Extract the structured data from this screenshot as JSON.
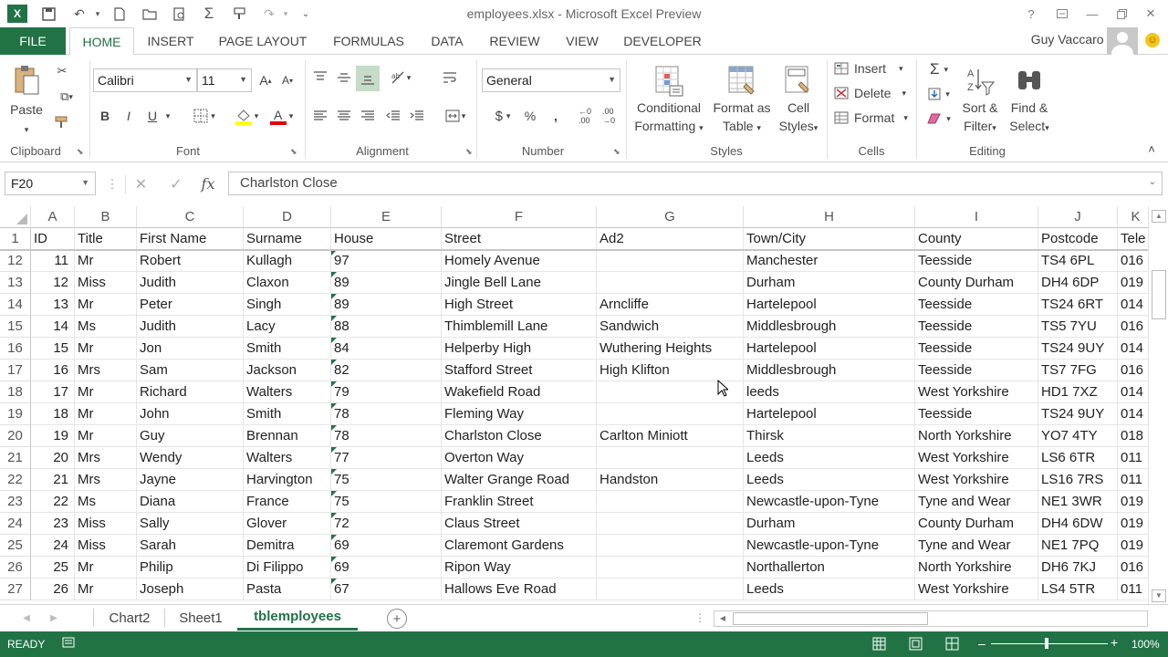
{
  "window": {
    "title": "employees.xlsx - Microsoft Excel Preview"
  },
  "ribbon_tabs": [
    "FILE",
    "HOME",
    "INSERT",
    "PAGE LAYOUT",
    "FORMULAS",
    "DATA",
    "REVIEW",
    "VIEW",
    "DEVELOPER"
  ],
  "active_tab": "HOME",
  "user": "Guy Vaccaro",
  "ribbon": {
    "clipboard": {
      "paste": "Paste",
      "label": "Clipboard"
    },
    "font": {
      "name": "Calibri",
      "size": "11",
      "label": "Font",
      "bold": "B",
      "italic": "I",
      "underline": "U"
    },
    "alignment": {
      "label": "Alignment"
    },
    "number": {
      "format": "General",
      "label": "Number",
      "currency": "$",
      "percent": "%"
    },
    "styles": {
      "conditional": [
        "Conditional",
        "Formatting"
      ],
      "format_table": [
        "Format as",
        "Table"
      ],
      "cell_styles": [
        "Cell",
        "Styles"
      ],
      "label": "Styles"
    },
    "cells": {
      "insert": "Insert",
      "delete": "Delete",
      "format": "Format",
      "label": "Cells"
    },
    "editing": {
      "sort": [
        "Sort &",
        "Filter"
      ],
      "find": [
        "Find &",
        "Select"
      ],
      "label": "Editing"
    }
  },
  "formula_bar": {
    "name_box": "F20",
    "fx": "fx",
    "content": "Charlston Close"
  },
  "columns": [
    "A",
    "B",
    "C",
    "D",
    "E",
    "F",
    "G",
    "H",
    "I",
    "J",
    "K"
  ],
  "header_row": {
    "row": "1",
    "cells": [
      "ID",
      "Title",
      "First Name",
      "Surname",
      "House",
      "Street",
      "Ad2",
      "Town/City",
      "County",
      "Postcode",
      "Tele"
    ]
  },
  "rows": [
    {
      "row": "12",
      "cells": [
        "11",
        "Mr",
        "Robert",
        "Kullagh",
        "97",
        "Homely Avenue",
        "",
        "Manchester",
        "Teesside",
        "TS4 6PL",
        "016"
      ]
    },
    {
      "row": "13",
      "cells": [
        "12",
        "Miss",
        "Judith",
        "Claxon",
        "89",
        "Jingle Bell Lane",
        "",
        "Durham",
        "County Durham",
        "DH4 6DP",
        "019"
      ]
    },
    {
      "row": "14",
      "cells": [
        "13",
        "Mr",
        "Peter",
        "Singh",
        "89",
        "High Street",
        "Arncliffe",
        "Hartelepool",
        "Teesside",
        "TS24 6RT",
        "014"
      ]
    },
    {
      "row": "15",
      "cells": [
        "14",
        "Ms",
        "Judith",
        "Lacy",
        "88",
        "Thimblemill Lane",
        "Sandwich",
        "Middlesbrough",
        "Teesside",
        "TS5 7YU",
        "016"
      ]
    },
    {
      "row": "16",
      "cells": [
        "15",
        "Mr",
        "Jon",
        "Smith",
        "84",
        "Helperby High",
        "Wuthering Heights",
        "Hartelepool",
        "Teesside",
        "TS24 9UY",
        "014"
      ]
    },
    {
      "row": "17",
      "cells": [
        "16",
        "Mrs",
        "Sam",
        "Jackson",
        "82",
        "Stafford Street",
        "High Klifton",
        "Middlesbrough",
        "Teesside",
        "TS7 7FG",
        "016"
      ]
    },
    {
      "row": "18",
      "cells": [
        "17",
        "Mr",
        "Richard",
        "Walters",
        "79",
        "Wakefield Road",
        "",
        "leeds",
        "West Yorkshire",
        "HD1 7XZ",
        "014"
      ]
    },
    {
      "row": "19",
      "cells": [
        "18",
        "Mr",
        "John",
        "Smith",
        "78",
        "Fleming Way",
        "",
        "Hartelepool",
        "Teesside",
        "TS24 9UY",
        "014"
      ]
    },
    {
      "row": "20",
      "cells": [
        "19",
        "Mr",
        "Guy",
        "Brennan",
        "78",
        "Charlston Close",
        "Carlton Miniott",
        "Thirsk",
        "North Yorkshire",
        "YO7 4TY",
        "018"
      ]
    },
    {
      "row": "21",
      "cells": [
        "20",
        "Mrs",
        "Wendy",
        "Walters",
        "77",
        "Overton Way",
        "",
        "Leeds",
        "West Yorkshire",
        "LS6 6TR",
        "011"
      ]
    },
    {
      "row": "22",
      "cells": [
        "21",
        "Mrs",
        "Jayne",
        "Harvington",
        "75",
        "Walter Grange Road",
        "Handston",
        "Leeds",
        "West Yorkshire",
        "LS16 7RS",
        "011"
      ]
    },
    {
      "row": "23",
      "cells": [
        "22",
        "Ms",
        "Diana",
        "France",
        "75",
        "Franklin Street",
        "",
        "Newcastle-upon-Tyne",
        "Tyne and Wear",
        "NE1 3WR",
        "019"
      ]
    },
    {
      "row": "24",
      "cells": [
        "23",
        "Miss",
        "Sally",
        "Glover",
        "72",
        "Claus Street",
        "",
        "Durham",
        "County Durham",
        "DH4 6DW",
        "019"
      ]
    },
    {
      "row": "25",
      "cells": [
        "24",
        "Miss",
        "Sarah",
        "Demitra",
        "69",
        "Claremont Gardens",
        "",
        "Newcastle-upon-Tyne",
        "Tyne and Wear",
        "NE1 7PQ",
        "019"
      ]
    },
    {
      "row": "26",
      "cells": [
        "25",
        "Mr",
        "Philip",
        "Di Filippo",
        "69",
        "Ripon Way",
        "",
        "Northallerton",
        "North Yorkshire",
        "DH6 7KJ",
        "016"
      ]
    },
    {
      "row": "27",
      "cells": [
        "26",
        "Mr",
        "Joseph",
        "Pasta",
        "67",
        "Hallows Eve Road",
        "",
        "Leeds",
        "West Yorkshire",
        "LS4 5TR",
        "011"
      ]
    }
  ],
  "sheets": [
    "Chart2",
    "Sheet1",
    "tblemployees"
  ],
  "active_sheet": "tblemployees",
  "status": {
    "mode": "READY",
    "zoom": "100%"
  },
  "colors": {
    "accent": "#217346",
    "text_number_marker": "#217346"
  }
}
